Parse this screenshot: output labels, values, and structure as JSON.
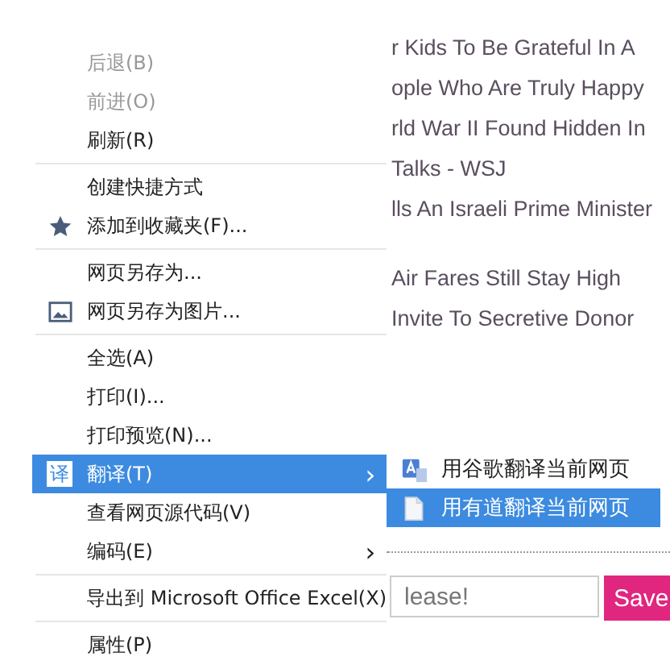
{
  "headlines": [
    "r Kids To Be Grateful In A",
    "ople Who Are Truly Happy",
    "rld War II Found Hidden In",
    "Talks - WSJ",
    "lls An Israeli Prime Minister",
    "Air Fares Still Stay High",
    "Invite To Secretive Donor"
  ],
  "signup": {
    "placeholder": "lease!",
    "button": "Save"
  },
  "context_menu": {
    "items": [
      {
        "kind": "item",
        "label": "后退(B)",
        "disabled": true,
        "selected": false
      },
      {
        "kind": "item",
        "label": "前进(O)",
        "disabled": true,
        "selected": false
      },
      {
        "kind": "item",
        "label": "刷新(R)",
        "disabled": false,
        "selected": false
      },
      {
        "kind": "separator"
      },
      {
        "kind": "item",
        "label": "创建快捷方式",
        "disabled": false,
        "selected": false
      },
      {
        "kind": "item",
        "label": "添加到收藏夹(F)...",
        "disabled": false,
        "selected": false
      },
      {
        "kind": "separator"
      },
      {
        "kind": "item",
        "label": "网页另存为...",
        "disabled": false,
        "selected": false
      },
      {
        "kind": "item",
        "label": "网页另存为图片...",
        "disabled": false,
        "selected": false
      },
      {
        "kind": "separator"
      },
      {
        "kind": "item",
        "label": "全选(A)",
        "disabled": false,
        "selected": false
      },
      {
        "kind": "item",
        "label": "打印(I)...",
        "disabled": false,
        "selected": false
      },
      {
        "kind": "item",
        "label": "打印预览(N)...",
        "disabled": false,
        "selected": false
      },
      {
        "kind": "item",
        "label": "翻译(T)",
        "disabled": false,
        "selected": true,
        "badge": "译",
        "arrow": "›"
      },
      {
        "kind": "item",
        "label": "查看网页源代码(V)",
        "disabled": false,
        "selected": false
      },
      {
        "kind": "item",
        "label": "编码(E)",
        "disabled": false,
        "selected": false,
        "arrow": "›"
      },
      {
        "kind": "separator"
      },
      {
        "kind": "item",
        "label": "导出到 Microsoft Office Excel(X)",
        "disabled": false,
        "selected": false
      },
      {
        "kind": "separator"
      },
      {
        "kind": "item",
        "label": "属性(P)",
        "disabled": false,
        "selected": false
      }
    ]
  },
  "submenu": {
    "items": [
      {
        "label": "用谷歌翻译当前网页",
        "selected": false
      },
      {
        "label": "用有道翻译当前网页",
        "selected": true
      }
    ]
  }
}
